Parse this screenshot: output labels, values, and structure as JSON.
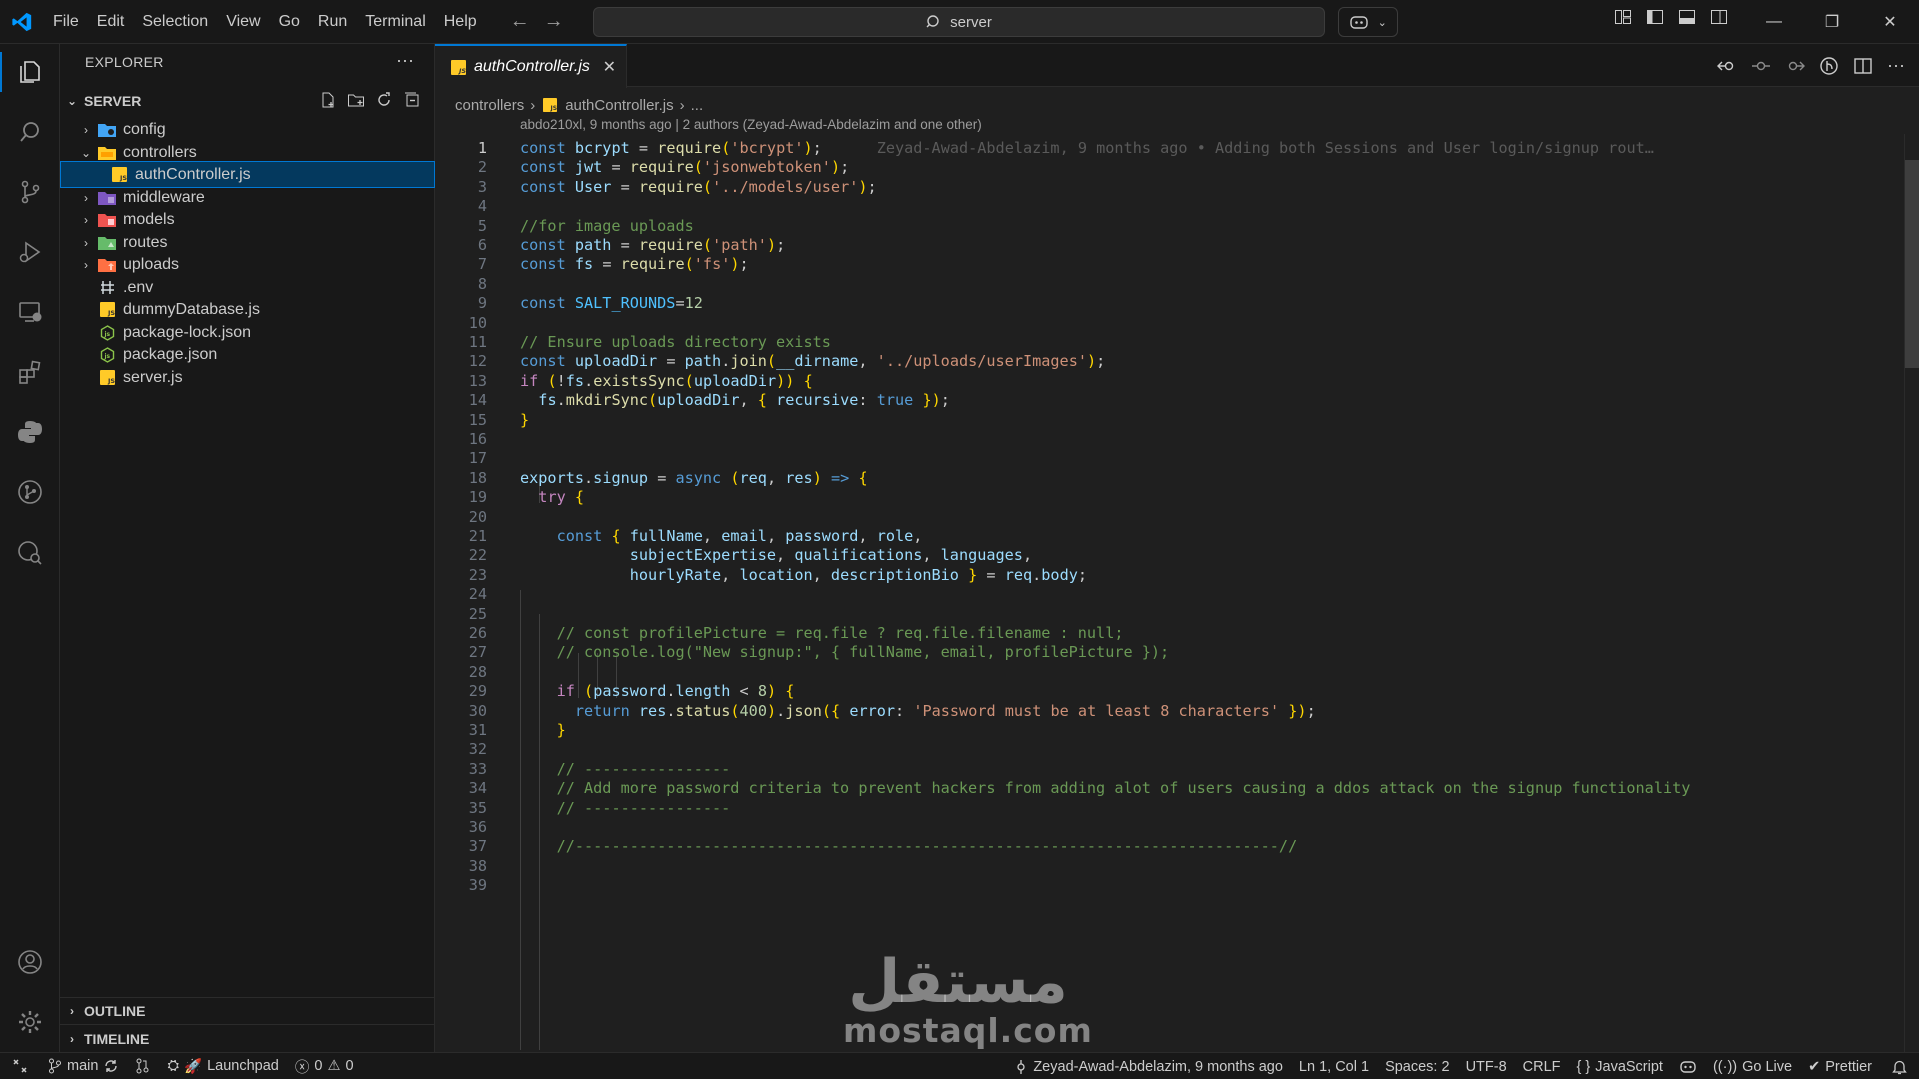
{
  "titlebar": {
    "menu": [
      "File",
      "Edit",
      "Selection",
      "View",
      "Go",
      "Run",
      "Terminal",
      "Help"
    ],
    "search_text": "server"
  },
  "sidebar": {
    "title": "EXPLORER",
    "root": "SERVER",
    "items": [
      {
        "label": "config",
        "kind": "folder",
        "color": "#42a5f5"
      },
      {
        "label": "controllers",
        "kind": "folder-open",
        "color": "#ffca28"
      },
      {
        "label": "authController.js",
        "kind": "js"
      },
      {
        "label": "middleware",
        "kind": "folder",
        "color": "#7e57c2"
      },
      {
        "label": "models",
        "kind": "folder",
        "color": "#ef5350"
      },
      {
        "label": "routes",
        "kind": "folder",
        "color": "#66bb6a"
      },
      {
        "label": "uploads",
        "kind": "folder",
        "color": "#ff7043"
      },
      {
        "label": ".env",
        "kind": "env"
      },
      {
        "label": "dummyDatabase.js",
        "kind": "js"
      },
      {
        "label": "package-lock.json",
        "kind": "node"
      },
      {
        "label": "package.json",
        "kind": "node"
      },
      {
        "label": "server.js",
        "kind": "js"
      }
    ],
    "outline": "OUTLINE",
    "timeline": "TIMELINE"
  },
  "editor": {
    "tab_label": "authController.js",
    "breadcrumb": [
      "controllers",
      "authController.js",
      "..."
    ],
    "blame_header": "abdo210xl, 9 months ago | 2 authors (Zeyad-Awad-Abdelazim and one other)",
    "blame_inline": "Zeyad-Awad-Abdelazim, 9 months ago • Adding both Sessions and User login/signup rout…"
  },
  "watermark": {
    "arabic": "مستقل",
    "latin": "mostaql.com"
  },
  "statusbar": {
    "branch": "main",
    "launchpad": "Launchpad",
    "errors": "0",
    "warnings": "0",
    "blame": "Zeyad-Awad-Abdelazim, 9 months ago",
    "position": "Ln 1, Col 1",
    "spaces": "Spaces: 2",
    "encoding": "UTF-8",
    "eol": "CRLF",
    "language": "JavaScript",
    "golive": "Go Live",
    "prettier": "Prettier"
  },
  "code_lines": [
    "const bcrypt = require('bcrypt');",
    "const jwt = require('jsonwebtoken');",
    "const User = require('../models/user');",
    "",
    "//for image uploads",
    "const path = require('path');",
    "const fs = require('fs');",
    "",
    "const SALT_ROUNDS=12",
    "",
    "// Ensure uploads directory exists",
    "const uploadDir = path.join(__dirname, '../uploads/userImages');",
    "if (!fs.existsSync(uploadDir)) {",
    "  fs.mkdirSync(uploadDir, { recursive: true });",
    "}",
    "",
    "",
    "exports.signup = async (req, res) => {",
    "  try {",
    "",
    "    const { fullName, email, password, role,",
    "            subjectExpertise, qualifications, languages,",
    "            hourlyRate, location, descriptionBio } = req.body;",
    "",
    "",
    "    // const profilePicture = req.file ? req.file.filename : null;",
    "    // console.log(\"New signup:\", { fullName, email, profilePicture });",
    "",
    "    if (password.length < 8) {",
    "      return res.status(400).json({ error: 'Password must be at least 8 characters' });",
    "    }",
    "",
    "    // ----------------",
    "    // Add more password criteria to prevent hackers from adding alot of users causing a ddos attack on the signup functionality",
    "    // ----------------",
    "",
    "    //-----------------------------------------------------------------------------//",
    "",
    ""
  ]
}
